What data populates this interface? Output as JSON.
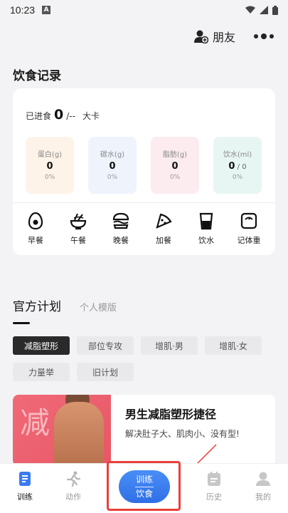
{
  "status_bar": {
    "time": "10:23",
    "app_glyph": "A"
  },
  "header": {
    "friends_label": "朋友"
  },
  "diet": {
    "title": "饮食记录",
    "intake_prefix": "已进食",
    "intake_value": "0",
    "intake_target": "/--",
    "intake_unit": "大卡",
    "macros": [
      {
        "label": "蛋白(g)",
        "value": "0",
        "extra": "",
        "pct": "0%",
        "color": "#fdf3e8"
      },
      {
        "label": "碳水(g)",
        "value": "0",
        "extra": "",
        "pct": "0%",
        "color": "#eef3fc"
      },
      {
        "label": "脂肪(g)",
        "value": "0",
        "extra": "",
        "pct": "0%",
        "color": "#fcecef"
      },
      {
        "label": "饮水(ml)",
        "value": "0",
        "extra": " / 0",
        "pct": "0%",
        "color": "#e8f6f3"
      }
    ],
    "meals": [
      "早餐",
      "午餐",
      "晚餐",
      "加餐",
      "饮水",
      "记体重"
    ]
  },
  "plans": {
    "tab_official": "官方计划",
    "tab_personal": "个人模版",
    "chips": [
      "减脂塑形",
      "部位专攻",
      "增肌·男",
      "增肌·女",
      "力量举",
      "旧计划"
    ],
    "selected_chip": "减脂塑形",
    "card": {
      "image_char": "减",
      "title": "男生减脂塑形捷径",
      "desc": "解决肚子大、肌肉小、没有型!"
    }
  },
  "nav": {
    "items": [
      "训练",
      "动作",
      "历史",
      "我的"
    ],
    "center_line1": "训练",
    "center_line2": "饮食",
    "active": "训练"
  },
  "colors": {
    "accent_blue": "#2f6fe6",
    "annotation_red": "#e8413a",
    "plan_pink": "#f06a78"
  }
}
